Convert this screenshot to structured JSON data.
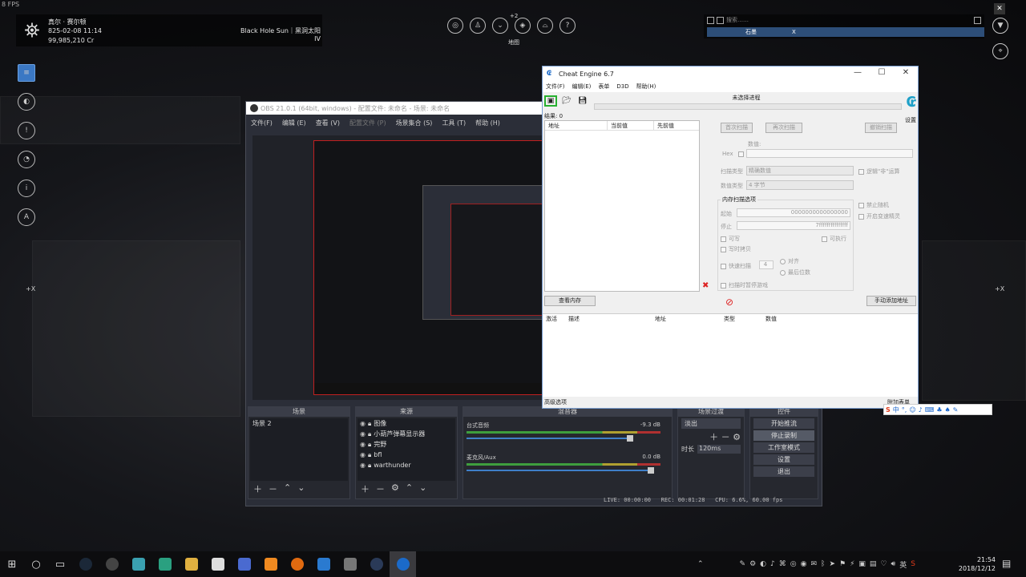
{
  "game": {
    "fps": "8 FPS",
    "commander": "真尔 · 赛尔顿",
    "datetime": "825-02-08 11:14",
    "credits": "99,985,210 Cr",
    "system": "Black Hole Sun｜黑洞太阳 IV",
    "top_count": "+2",
    "top_caption": "地图",
    "search_placeholder": "搜索……",
    "search_tab": "石墨",
    "search_tab_close": "X",
    "side_left": "+X",
    "side_right": "+X"
  },
  "obs": {
    "title": "OBS 21.0.1 (64bit, windows) - 配置文件: 未命名 - 场景: 未命名",
    "menu": [
      "文件(F)",
      "编辑 (E)",
      "查看 (V)",
      "配置文件 (P)",
      "场景集合 (S)",
      "工具 (T)",
      "帮助 (H)"
    ],
    "docks": {
      "scenes": "场景",
      "sources": "来源",
      "mixer": "混音器",
      "transitions": "场景过渡",
      "controls": "控件"
    },
    "scenes": [
      "场景 2"
    ],
    "sources": [
      "图像",
      "小葫芦弹幕显示器",
      "完野",
      "bfl",
      "warthunder"
    ],
    "mixer": [
      {
        "name": "台式音频",
        "db": "-9.3 dB"
      },
      {
        "name": "麦克风/Aux",
        "db": "0.0 dB"
      }
    ],
    "transition": {
      "type": "淡出",
      "duration_label": "时长",
      "duration": "120ms"
    },
    "controls": [
      "开始推流",
      "停止录制",
      "工作室模式",
      "设置",
      "退出"
    ],
    "status": {
      "live": "LIVE: 00:00:00",
      "rec": "REC: 00:01:28",
      "cpu": "CPU: 6.6%, 60.00 fps"
    }
  },
  "ce": {
    "title": "Cheat Engine 6.7",
    "menu": [
      "文件(F)",
      "编辑(E)",
      "表单",
      "D3D",
      "帮助(H)"
    ],
    "process": "未选择进程",
    "settings": "设置",
    "found": "结果: 0",
    "columns": [
      "地址",
      "当前值",
      "先前值"
    ],
    "first_scan": "首次扫描",
    "next_scan": "再次扫描",
    "undo_scan": "撤销扫描",
    "value_label": "数值:",
    "hex": "Hex",
    "scan_type_label": "扫描类型",
    "scan_type": "精确数值",
    "value_type_label": "数值类型",
    "value_type": "4 字节",
    "not_op": "逻辑\"非\"运算",
    "memory_options": "内存扫描选项",
    "start_label": "起始",
    "start_value": "0000000000000000",
    "stop_label": "停止",
    "stop_value": "7fffffffffffffff",
    "writable": "可写",
    "executable": "可执行",
    "copy_on_write": "写时拷贝",
    "fast_scan": "快速扫描",
    "fast_scan_value": "4",
    "align": "对齐",
    "last_digits": "最后位数",
    "pause": "扫描时暂停游戏",
    "disable_random": "禁止随机",
    "speedhack": "开启变速精灵",
    "view_memory": "查看内存",
    "add_address": "手动添加地址",
    "table_columns": [
      "激活",
      "描述",
      "地址",
      "类型",
      "数值"
    ],
    "advanced": "高级选项",
    "table_extras": "附加表单"
  },
  "taskbar": {
    "time": "21:54",
    "date": "2018/12/12"
  }
}
